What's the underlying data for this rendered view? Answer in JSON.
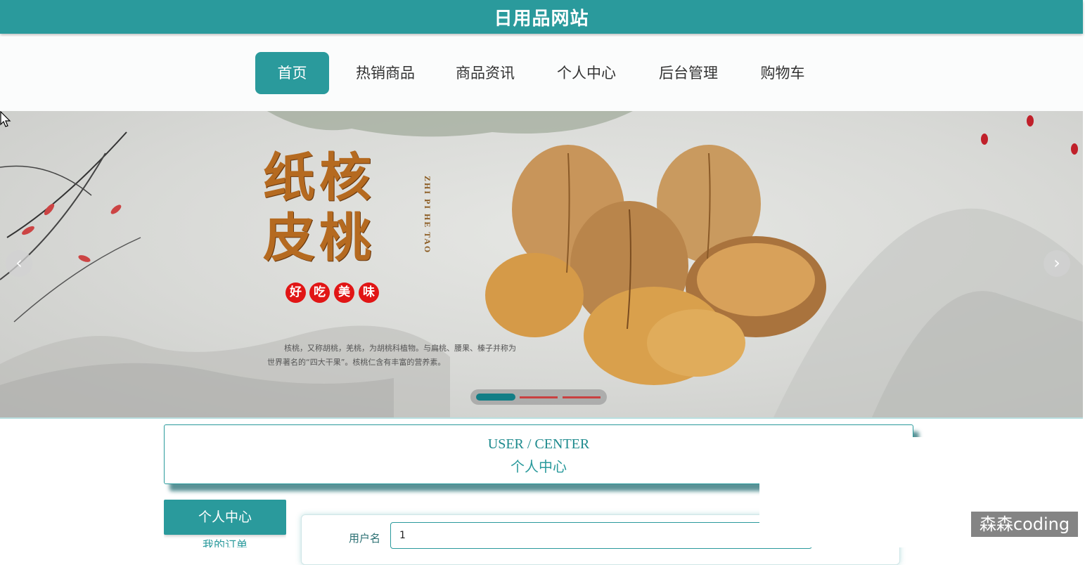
{
  "site": {
    "title": "日用品网站"
  },
  "nav": {
    "items": [
      {
        "label": "首页",
        "active": true
      },
      {
        "label": "热销商品"
      },
      {
        "label": "商品资讯"
      },
      {
        "label": "个人中心"
      },
      {
        "label": "后台管理"
      },
      {
        "label": "购物车"
      }
    ]
  },
  "banner": {
    "title_line1": "纸核",
    "title_line2": "皮桃",
    "pinyin": "ZHI PI HE TAO",
    "taste": [
      "好",
      "吃",
      "美",
      "味"
    ],
    "description": "核桃，又称胡桃，羌桃，为胡桃科植物。与扁桃、腰果、榛子并称为世界著名的“四大干果”。核桃仁含有丰富的营养素。",
    "prev_icon": "chevron-left-icon",
    "next_icon": "chevron-right-icon",
    "active_slide": 1,
    "slide_count": 3
  },
  "section": {
    "title_en": "USER / CENTER",
    "title_cn": "个人中心"
  },
  "sidebar": {
    "header": "个人中心",
    "items": [
      {
        "label": "我的订单"
      }
    ]
  },
  "form": {
    "username_label": "用户名",
    "username_value": "1"
  },
  "watermark": "森森coding",
  "colors": {
    "primary": "#2a9a9c",
    "accent_red": "#e11515"
  }
}
